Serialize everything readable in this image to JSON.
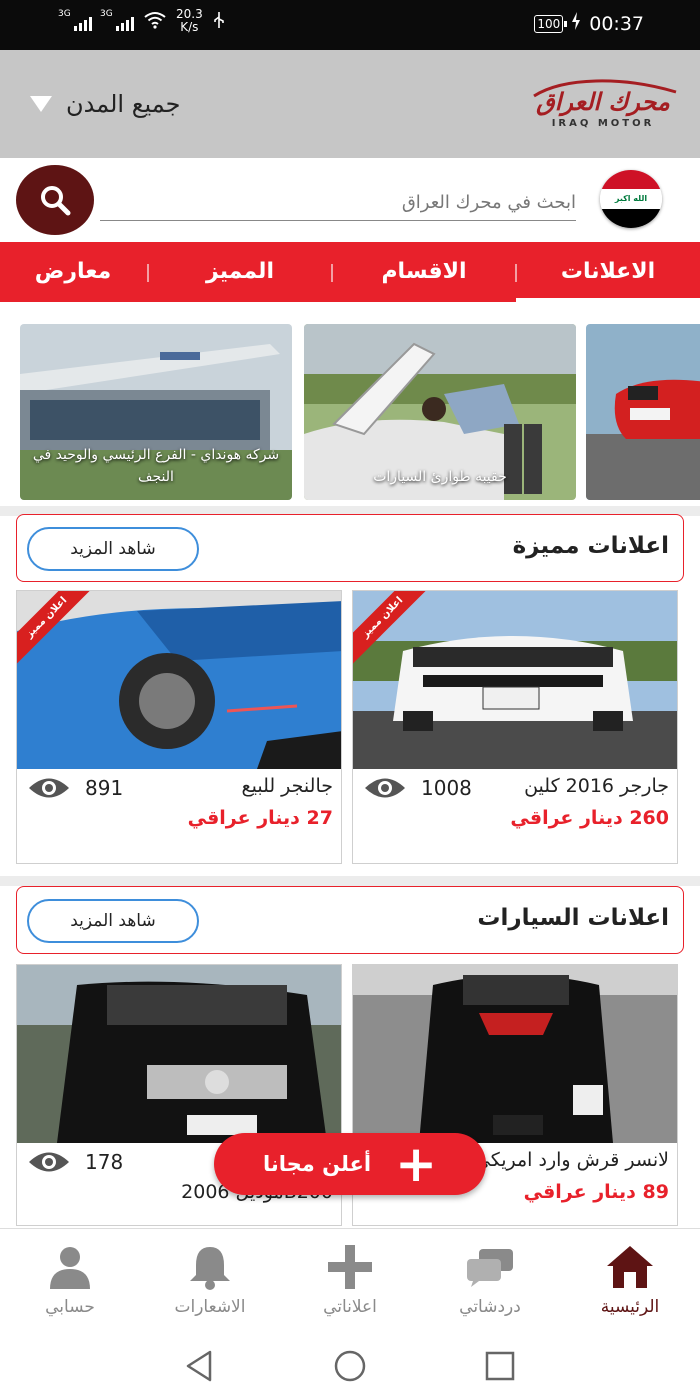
{
  "status_bar": {
    "signal1_label": "3G",
    "signal2_label": "3G",
    "net_speed": "20.3",
    "net_speed_unit": "K/s",
    "battery": "100",
    "time": "00:37"
  },
  "header": {
    "logo_text": "محرك العراق",
    "logo_sub": "IRAQ MOTOR",
    "city_select": "جميع المدن"
  },
  "search": {
    "placeholder": "ابحث في محرك العراق",
    "flag_text": "الله اكبر"
  },
  "tabs": [
    {
      "label": "الاعلانات",
      "active": true
    },
    {
      "label": "الاقسام",
      "active": false
    },
    {
      "label": "المميز",
      "active": false
    },
    {
      "label": "معارض",
      "active": false
    }
  ],
  "carousel": [
    {
      "caption": "شركه هونداي - الفرع الرئيسي والوحيد في النجف"
    },
    {
      "caption": "حقيبه طوارئ السيارات"
    },
    {
      "caption": ""
    }
  ],
  "featured": {
    "title": "اعلانات مميزة",
    "more_label": "شاهد المزيد",
    "ribbon_label": "اعلان مميز",
    "cards": [
      {
        "title": "جارجر 2016 كلين",
        "views": "1008",
        "price": "260 دينار عراقي"
      },
      {
        "title": "جالنجر للبيع",
        "views": "891",
        "price": "27 دينار عراقي"
      }
    ]
  },
  "cars": {
    "title": "اعلانات السيارات",
    "more_label": "شاهد المزيد",
    "cards": [
      {
        "title": "لانسر قرش وارد امريكي",
        "views": "",
        "price": "89 دينار عراقي"
      },
      {
        "title": "B200موديل 2006",
        "views": "178",
        "price": ""
      }
    ]
  },
  "fab": {
    "label": "أعلن مجانا"
  },
  "bottom_nav": [
    {
      "label": "الرئيسية",
      "icon": "home-icon",
      "active": true
    },
    {
      "label": "دردشاتي",
      "icon": "chat-icon",
      "active": false
    },
    {
      "label": "اعلاناتي",
      "icon": "plus-icon",
      "active": false
    },
    {
      "label": "الاشعارات",
      "icon": "bell-icon",
      "active": false
    },
    {
      "label": "حسابي",
      "icon": "user-icon",
      "active": false
    }
  ],
  "colors": {
    "accent_red": "#e8212b",
    "dark_maroon": "#5e1414",
    "header_gray": "#c6c6c6",
    "link_blue": "#3e8edb"
  }
}
